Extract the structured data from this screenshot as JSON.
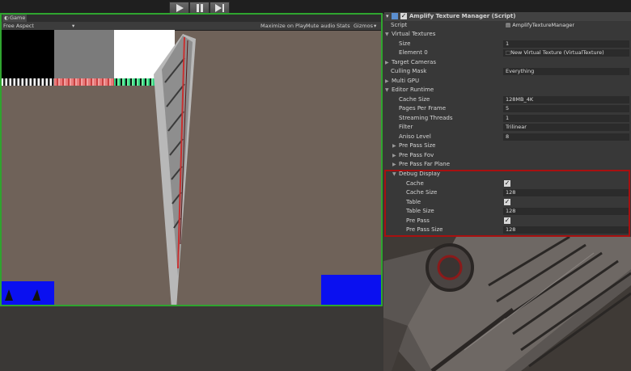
{
  "toolbar": {
    "play_icon": "play-icon",
    "pause_icon": "pause-icon",
    "step_icon": "step-icon"
  },
  "game": {
    "tab_label": "Game",
    "aspect": "Free Aspect",
    "options": [
      "Maximize on Play",
      "Mute audio",
      "Stats",
      "Gizmos"
    ],
    "border_color": "#2fa52f"
  },
  "inspector": {
    "component_title": "Amplify Texture Manager (Script)",
    "script_label": "Script",
    "script_value": "AmplifyTextureManager",
    "virtual_textures_label": "Virtual Textures",
    "size_label": "Size",
    "size_value": "1",
    "element0_label": "Element 0",
    "element0_value": "New Virtual Texture (VirtualTexture)",
    "target_cameras_label": "Target Cameras",
    "culling_mask_label": "Culling Mask",
    "culling_mask_value": "Everything",
    "multi_gpu_label": "Multi GPU",
    "editor_runtime_label": "Editor Runtime",
    "cache_size_label": "Cache Size",
    "cache_size_value": "128MB_4K",
    "pages_per_frame_label": "Pages Per Frame",
    "pages_per_frame_value": "5",
    "streaming_threads_label": "Streaming Threads",
    "streaming_threads_value": "1",
    "filter_label": "Filter",
    "filter_value": "Trilinear",
    "aniso_level_label": "Aniso Level",
    "aniso_level_value": "8",
    "pre_pass_size_label": "Pre Pass Size",
    "pre_pass_fov_label": "Pre Pass Fov",
    "pre_pass_far_plane_label": "Pre Pass Far Plane",
    "debug_display_label": "Debug Display",
    "debug_cache_label": "Cache",
    "debug_cache_size_label": "Cache Size",
    "debug_cache_size_value": "128",
    "debug_table_label": "Table",
    "debug_table_size_label": "Table Size",
    "debug_table_size_value": "128",
    "debug_pre_pass_label": "Pre Pass",
    "debug_pre_pass_size_label": "Pre Pass Size",
    "debug_pre_pass_size_value": "128",
    "highlight_color": "#a81010"
  }
}
